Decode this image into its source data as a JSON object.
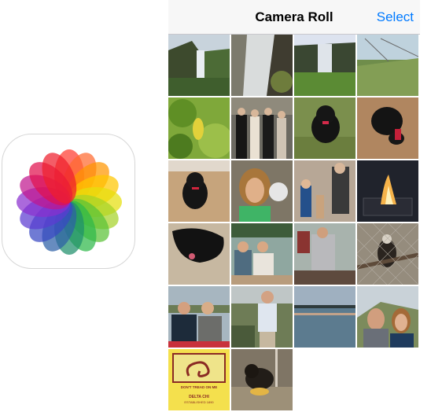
{
  "app_icon": {
    "name": "photos-app-icon",
    "petal_colors": [
      "#ff3b30",
      "#ff6a2f",
      "#ff9500",
      "#ffc600",
      "#e6df0c",
      "#a5d228",
      "#5ac236",
      "#2eb84a",
      "#1e8f6b",
      "#2c5fa6",
      "#3948c4",
      "#5b3bd1",
      "#8a2fcf",
      "#c1188f",
      "#e0114e",
      "#ef1f2c"
    ]
  },
  "nav": {
    "title": "Camera Roll",
    "select_label": "Select",
    "accent_color": "#007aff"
  },
  "photos": [
    {
      "subject": "waterfall-cliff-green"
    },
    {
      "subject": "waterfall-rocks-close"
    },
    {
      "subject": "waterfall-valley"
    },
    {
      "subject": "grassy-dunes"
    },
    {
      "subject": "green-leaves-yellow-leaf"
    },
    {
      "subject": "group-formal-house"
    },
    {
      "subject": "black-puppy-grass"
    },
    {
      "subject": "black-puppy-floor"
    },
    {
      "subject": "black-puppy-wood-floor"
    },
    {
      "subject": "woman-selfie-puppy"
    },
    {
      "subject": "group-party-room"
    },
    {
      "subject": "campfire-night"
    },
    {
      "subject": "black-dog-sand"
    },
    {
      "subject": "couple-boat-lake"
    },
    {
      "subject": "man-woman-boat"
    },
    {
      "subject": "eagle-cage"
    },
    {
      "subject": "couple-lake-hills"
    },
    {
      "subject": "man-boat-shore"
    },
    {
      "subject": "lake-sunset"
    },
    {
      "subject": "couple-selfie-hills"
    },
    {
      "subject": "dont-tread-on-me-flag",
      "text_top": "DON'T TREAD ON ME",
      "text_mid": "DELTA CHI",
      "text_bot": "ESTABLISHED 1890"
    },
    {
      "subject": "dog-with-toy-floor"
    }
  ]
}
